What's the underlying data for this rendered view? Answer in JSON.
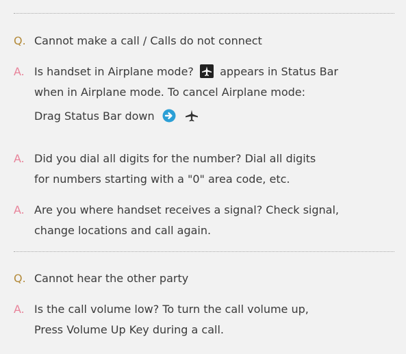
{
  "sections": [
    {
      "question": {
        "marker": "Q.",
        "text": "Cannot make a call / Calls do not connect"
      },
      "answers": [
        {
          "marker": "A.",
          "line1_a": "Is handset in Airplane mode?",
          "line1_b": "appears in Status Bar",
          "line2": "when in Airplane mode. To cancel Airplane mode:",
          "line3": "Drag Status Bar down",
          "icons": [
            "airplane-status-icon",
            "arrow-right-circle-icon",
            "airplane-icon"
          ]
        },
        {
          "marker": "A.",
          "line1": "Did you dial all digits for the number? Dial all digits",
          "line2": "for numbers starting with a \"0\" area code, etc."
        },
        {
          "marker": "A.",
          "line1": "Are you where handset receives a signal? Check signal,",
          "line2": "change locations and call again."
        }
      ]
    },
    {
      "question": {
        "marker": "Q.",
        "text": "Cannot hear the other party"
      },
      "answers": [
        {
          "marker": "A.",
          "line1": "Is the call volume low? To turn the call volume up,",
          "line2": "Press Volume Up Key during a call."
        }
      ]
    }
  ],
  "colors": {
    "q_marker": "#b38a3a",
    "a_marker": "#e8839a",
    "arrow_icon": "#2b9fd6",
    "text": "#3a3a3a",
    "panel_bg": "#f2f2f2"
  }
}
